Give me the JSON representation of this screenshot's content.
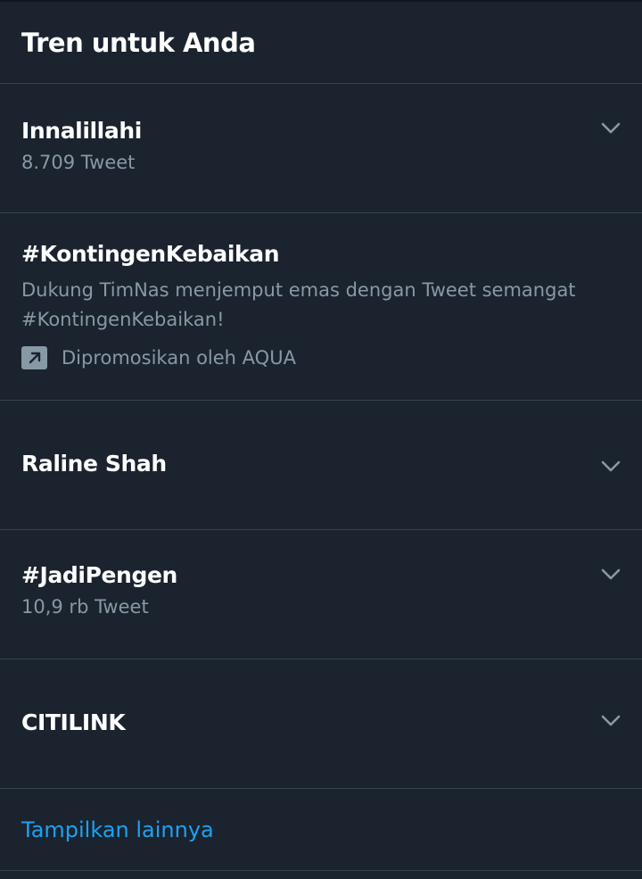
{
  "header": {
    "title": "Tren untuk Anda"
  },
  "trends": [
    {
      "name": "Innalillahi",
      "meta": "8.709 Tweet"
    },
    {
      "name": "#KontingenKebaikan",
      "description_line1": "Dukung TimNas menjemput emas dengan Tweet semangat",
      "description_line2": "#KontingenKebaikan!",
      "promoted": "Dipromosikan oleh AQUA"
    },
    {
      "name": "Raline Shah"
    },
    {
      "name": "#JadiPengen",
      "meta": "10,9 rb Tweet"
    },
    {
      "name": "CITILINK"
    }
  ],
  "footer": {
    "show_more_label": "Tampilkan lainnya"
  },
  "colors": {
    "background": "#1a232e",
    "divider": "#38444d",
    "secondary_text": "#8899a6",
    "link": "#1da1f2"
  },
  "icons": {
    "chevron": "chevron-down-icon",
    "promoted": "promoted-arrow-icon"
  }
}
